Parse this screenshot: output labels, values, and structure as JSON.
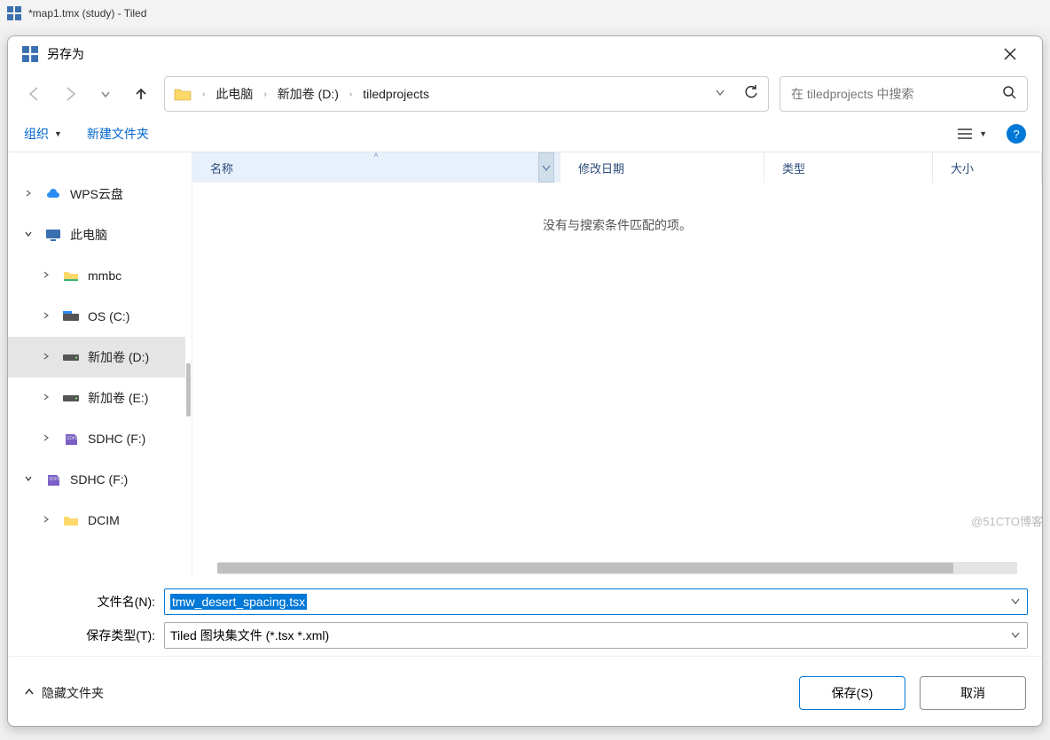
{
  "app": {
    "title": "*map1.tmx (study) - Tiled"
  },
  "dialog": {
    "title": "另存为",
    "breadcrumb": [
      "此电脑",
      "新加卷 (D:)",
      "tiledprojects"
    ],
    "search_placeholder": "在 tiledprojects 中搜索",
    "toolbar": {
      "organize": "组织",
      "new_folder": "新建文件夹"
    },
    "columns": {
      "name": "名称",
      "modified": "修改日期",
      "type": "类型",
      "size": "大小"
    },
    "empty_msg": "没有与搜索条件匹配的项。",
    "sidebar": [
      {
        "label": "WPS云盘",
        "icon": "cloud",
        "expandable": true,
        "expanded": false,
        "depth": 0
      },
      {
        "label": "此电脑",
        "icon": "pc",
        "expandable": true,
        "expanded": true,
        "depth": 0
      },
      {
        "label": "mmbc",
        "icon": "folder-green",
        "expandable": true,
        "expanded": false,
        "depth": 1
      },
      {
        "label": "OS (C:)",
        "icon": "drive-os",
        "expandable": true,
        "expanded": false,
        "depth": 1
      },
      {
        "label": "新加卷 (D:)",
        "icon": "drive",
        "expandable": true,
        "expanded": false,
        "depth": 1,
        "selected": true
      },
      {
        "label": "新加卷 (E:)",
        "icon": "drive",
        "expandable": true,
        "expanded": false,
        "depth": 1
      },
      {
        "label": "SDHC (F:)",
        "icon": "sdhc",
        "expandable": true,
        "expanded": false,
        "depth": 1
      },
      {
        "label": "SDHC (F:)",
        "icon": "sdhc",
        "expandable": true,
        "expanded": true,
        "depth": 0
      },
      {
        "label": "DCIM",
        "icon": "folder",
        "expandable": true,
        "expanded": false,
        "depth": 1
      }
    ],
    "form": {
      "filename_label": "文件名(N):",
      "filename_value": "tmw_desert_spacing.tsx",
      "filetype_label": "保存类型(T):",
      "filetype_value": "Tiled 图块集文件 (*.tsx *.xml)"
    },
    "footer": {
      "hide_folders": "隐藏文件夹",
      "save": "保存(S)",
      "cancel": "取消"
    }
  },
  "watermark": "@51CTO博客"
}
